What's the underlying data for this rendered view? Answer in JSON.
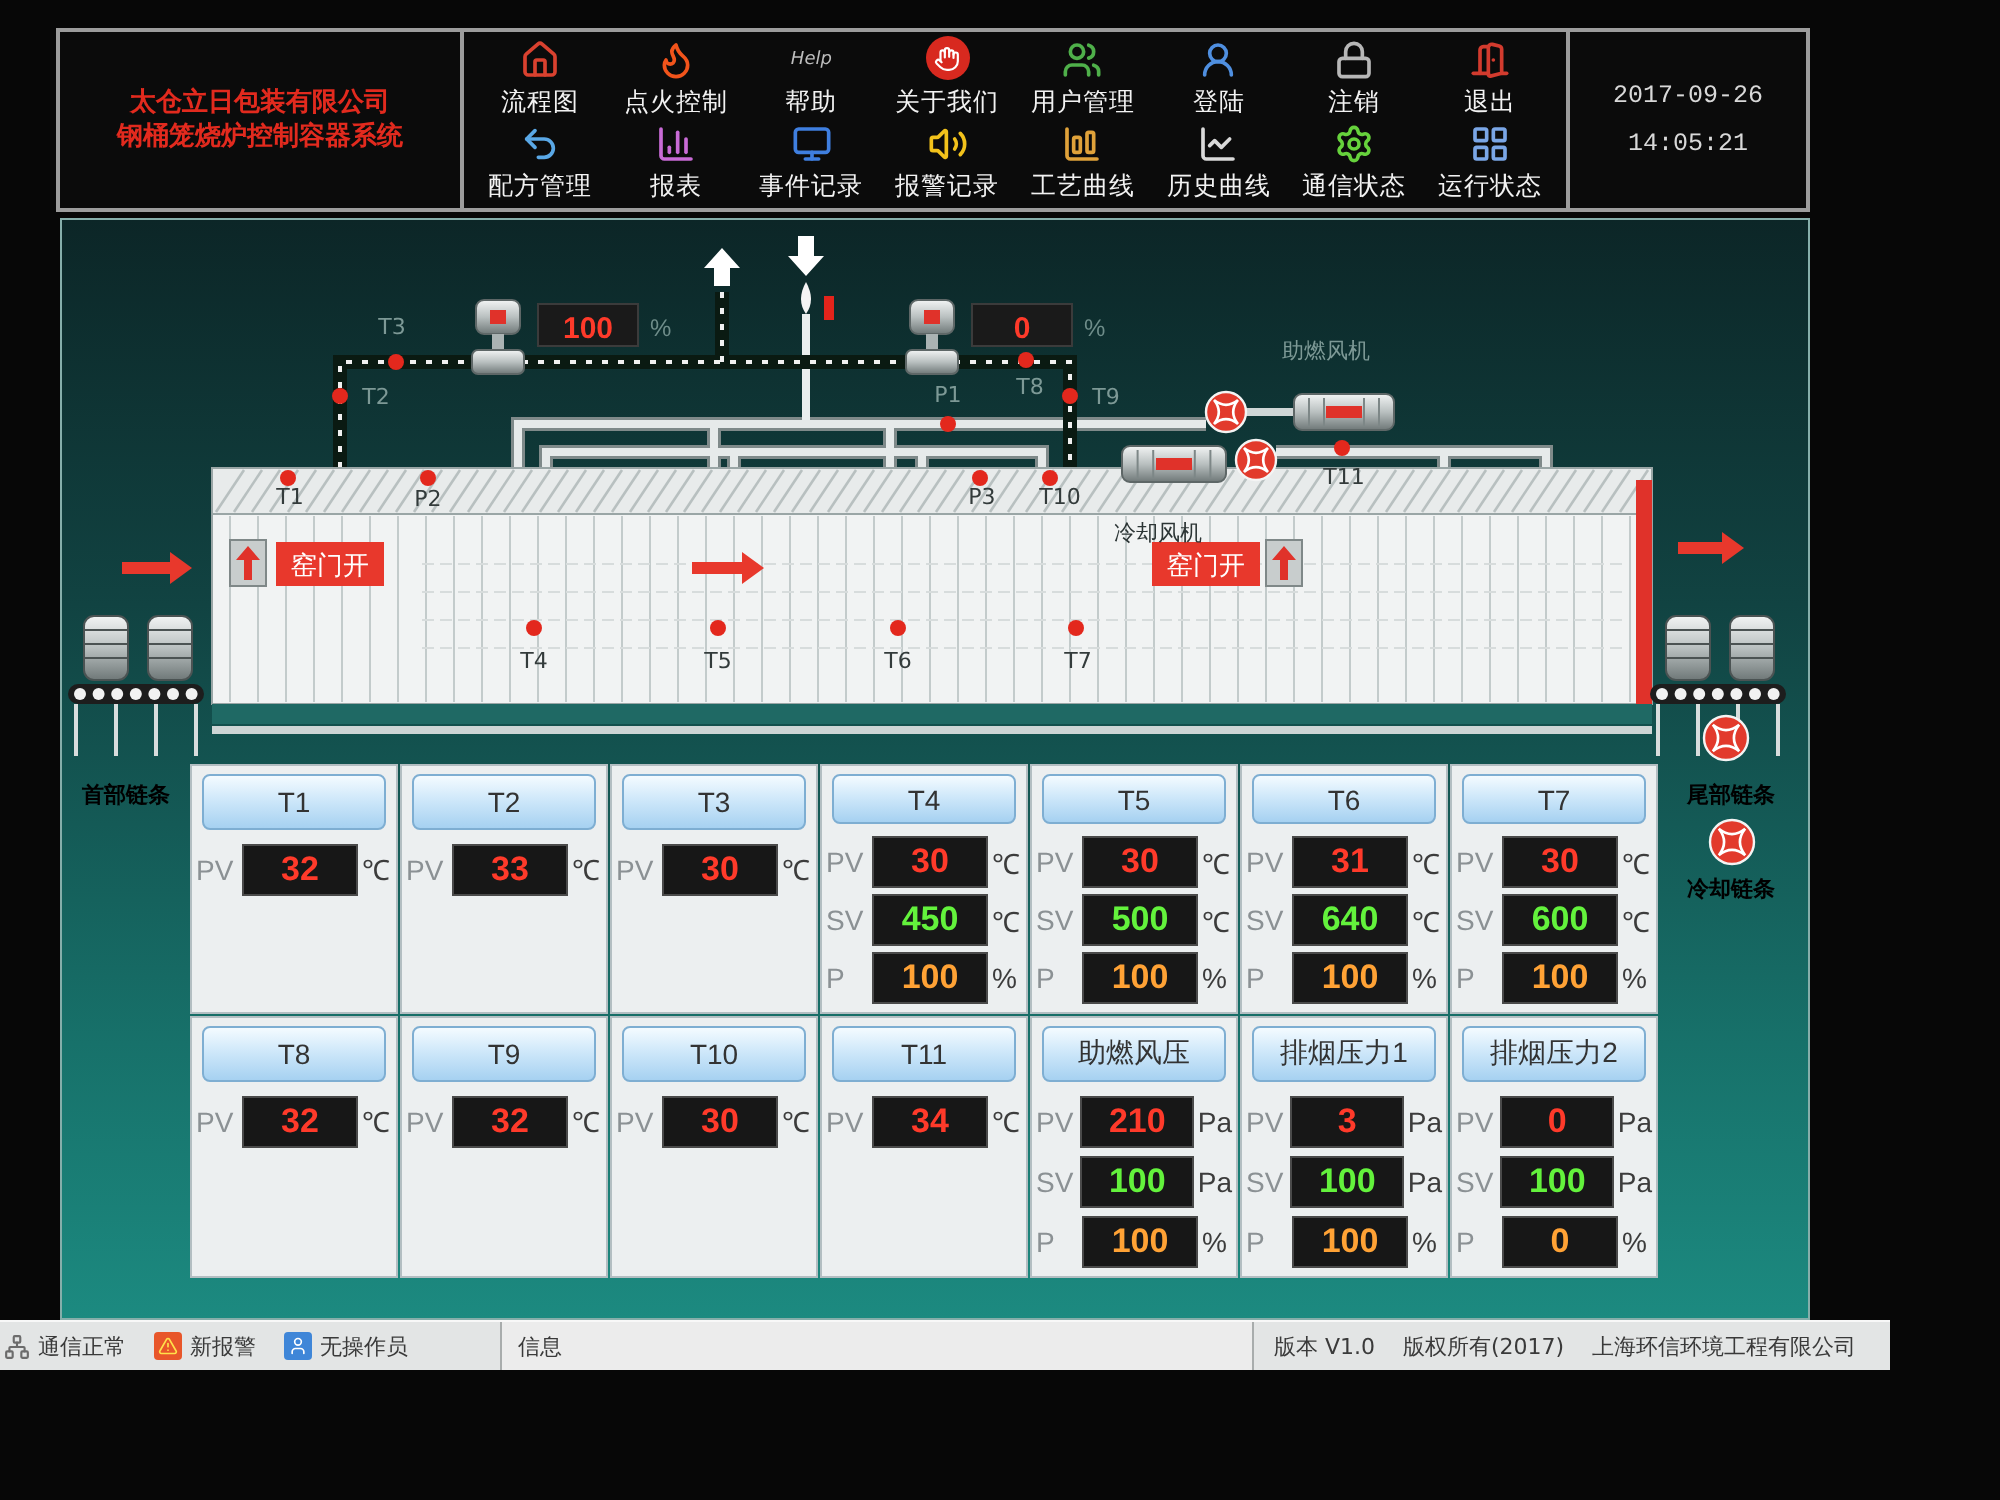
{
  "header": {
    "company": [
      "太仓立日包装有限公司",
      "钢桶笼烧炉控制容器系统"
    ],
    "menu": [
      [
        {
          "label": "流程图"
        },
        {
          "label": "点火控制"
        },
        {
          "label": "帮助",
          "icon_text": "Help"
        },
        {
          "label": "关于我们"
        },
        {
          "label": "用户管理"
        },
        {
          "label": "登陆"
        },
        {
          "label": "注销"
        },
        {
          "label": "退出"
        }
      ],
      [
        {
          "label": "配方管理"
        },
        {
          "label": "报表"
        },
        {
          "label": "事件记录"
        },
        {
          "label": "报警记录"
        },
        {
          "label": "工艺曲线"
        },
        {
          "label": "历史曲线"
        },
        {
          "label": "通信状态"
        },
        {
          "label": "运行状态"
        }
      ]
    ],
    "date": "2017-09-26",
    "time": "14:05:21"
  },
  "diagram": {
    "valves": [
      {
        "value": "100",
        "unit": "%"
      },
      {
        "value": "0",
        "unit": "%"
      }
    ],
    "sensors": [
      {
        "label": "T3"
      },
      {
        "label": "T2"
      },
      {
        "label": "P1"
      },
      {
        "label": "T8"
      },
      {
        "label": "T9"
      },
      {
        "label": "T1"
      },
      {
        "label": "P2"
      },
      {
        "label": "P3"
      },
      {
        "label": "T10"
      },
      {
        "label": "T11"
      },
      {
        "label": "T4"
      },
      {
        "label": "T5"
      },
      {
        "label": "T6"
      },
      {
        "label": "T7"
      }
    ],
    "fans": [
      {
        "label": "助燃风机"
      },
      {
        "label": "冷却风机"
      }
    ],
    "doors": [
      {
        "label": "窑门开"
      },
      {
        "label": "窑门开"
      }
    ]
  },
  "conveyor_labels": {
    "left": "首部链条",
    "right": [
      "尾部链条",
      "冷却链条"
    ]
  },
  "cards": [
    [
      {
        "title": "T1",
        "rows": [
          {
            "kind": "pv",
            "label": "PV",
            "value": "32",
            "unit": "℃"
          }
        ]
      },
      {
        "title": "T2",
        "rows": [
          {
            "kind": "pv",
            "label": "PV",
            "value": "33",
            "unit": "℃"
          }
        ]
      },
      {
        "title": "T3",
        "rows": [
          {
            "kind": "pv",
            "label": "PV",
            "value": "30",
            "unit": "℃"
          }
        ]
      },
      {
        "title": "T4",
        "rows": [
          {
            "kind": "pv",
            "label": "PV",
            "value": "30",
            "unit": "℃"
          },
          {
            "kind": "sv",
            "label": "SV",
            "value": "450",
            "unit": "℃"
          },
          {
            "kind": "p",
            "label": "P",
            "value": "100",
            "unit": "%"
          }
        ]
      },
      {
        "title": "T5",
        "rows": [
          {
            "kind": "pv",
            "label": "PV",
            "value": "30",
            "unit": "℃"
          },
          {
            "kind": "sv",
            "label": "SV",
            "value": "500",
            "unit": "℃"
          },
          {
            "kind": "p",
            "label": "P",
            "value": "100",
            "unit": "%"
          }
        ]
      },
      {
        "title": "T6",
        "rows": [
          {
            "kind": "pv",
            "label": "PV",
            "value": "31",
            "unit": "℃"
          },
          {
            "kind": "sv",
            "label": "SV",
            "value": "640",
            "unit": "℃"
          },
          {
            "kind": "p",
            "label": "P",
            "value": "100",
            "unit": "%"
          }
        ]
      },
      {
        "title": "T7",
        "rows": [
          {
            "kind": "pv",
            "label": "PV",
            "value": "30",
            "unit": "℃"
          },
          {
            "kind": "sv",
            "label": "SV",
            "value": "600",
            "unit": "℃"
          },
          {
            "kind": "p",
            "label": "P",
            "value": "100",
            "unit": "%"
          }
        ]
      }
    ],
    [
      {
        "title": "T8",
        "rows": [
          {
            "kind": "pv",
            "label": "PV",
            "value": "32",
            "unit": "℃"
          }
        ]
      },
      {
        "title": "T9",
        "rows": [
          {
            "kind": "pv",
            "label": "PV",
            "value": "32",
            "unit": "℃"
          }
        ]
      },
      {
        "title": "T10",
        "rows": [
          {
            "kind": "pv",
            "label": "PV",
            "value": "30",
            "unit": "℃"
          }
        ]
      },
      {
        "title": "T11",
        "rows": [
          {
            "kind": "pv",
            "label": "PV",
            "value": "34",
            "unit": "℃"
          }
        ]
      },
      {
        "title": "助燃风压",
        "rows": [
          {
            "kind": "pv",
            "label": "PV",
            "value": "210",
            "unit": "Pa"
          },
          {
            "kind": "sv",
            "label": "SV",
            "value": "100",
            "unit": "Pa"
          },
          {
            "kind": "p",
            "label": "P",
            "value": "100",
            "unit": "%"
          }
        ]
      },
      {
        "title": "排烟压力1",
        "rows": [
          {
            "kind": "pv",
            "label": "PV",
            "value": "3",
            "unit": "Pa"
          },
          {
            "kind": "sv",
            "label": "SV",
            "value": "100",
            "unit": "Pa"
          },
          {
            "kind": "p",
            "label": "P",
            "value": "100",
            "unit": "%"
          }
        ]
      },
      {
        "title": "排烟压力2",
        "rows": [
          {
            "kind": "pv",
            "label": "PV",
            "value": "0",
            "unit": "Pa"
          },
          {
            "kind": "sv",
            "label": "SV",
            "value": "100",
            "unit": "Pa"
          },
          {
            "kind": "p",
            "label": "P",
            "value": "0",
            "unit": "%"
          }
        ]
      }
    ]
  ],
  "status_bar": {
    "items": [
      {
        "label": "通信正常"
      },
      {
        "label": "新报警"
      },
      {
        "label": "无操作员"
      }
    ],
    "message_label": "信息",
    "version": "版本 V1.0",
    "copyright": "版权所有(2017)",
    "company": "上海环信环境工程有限公司"
  }
}
